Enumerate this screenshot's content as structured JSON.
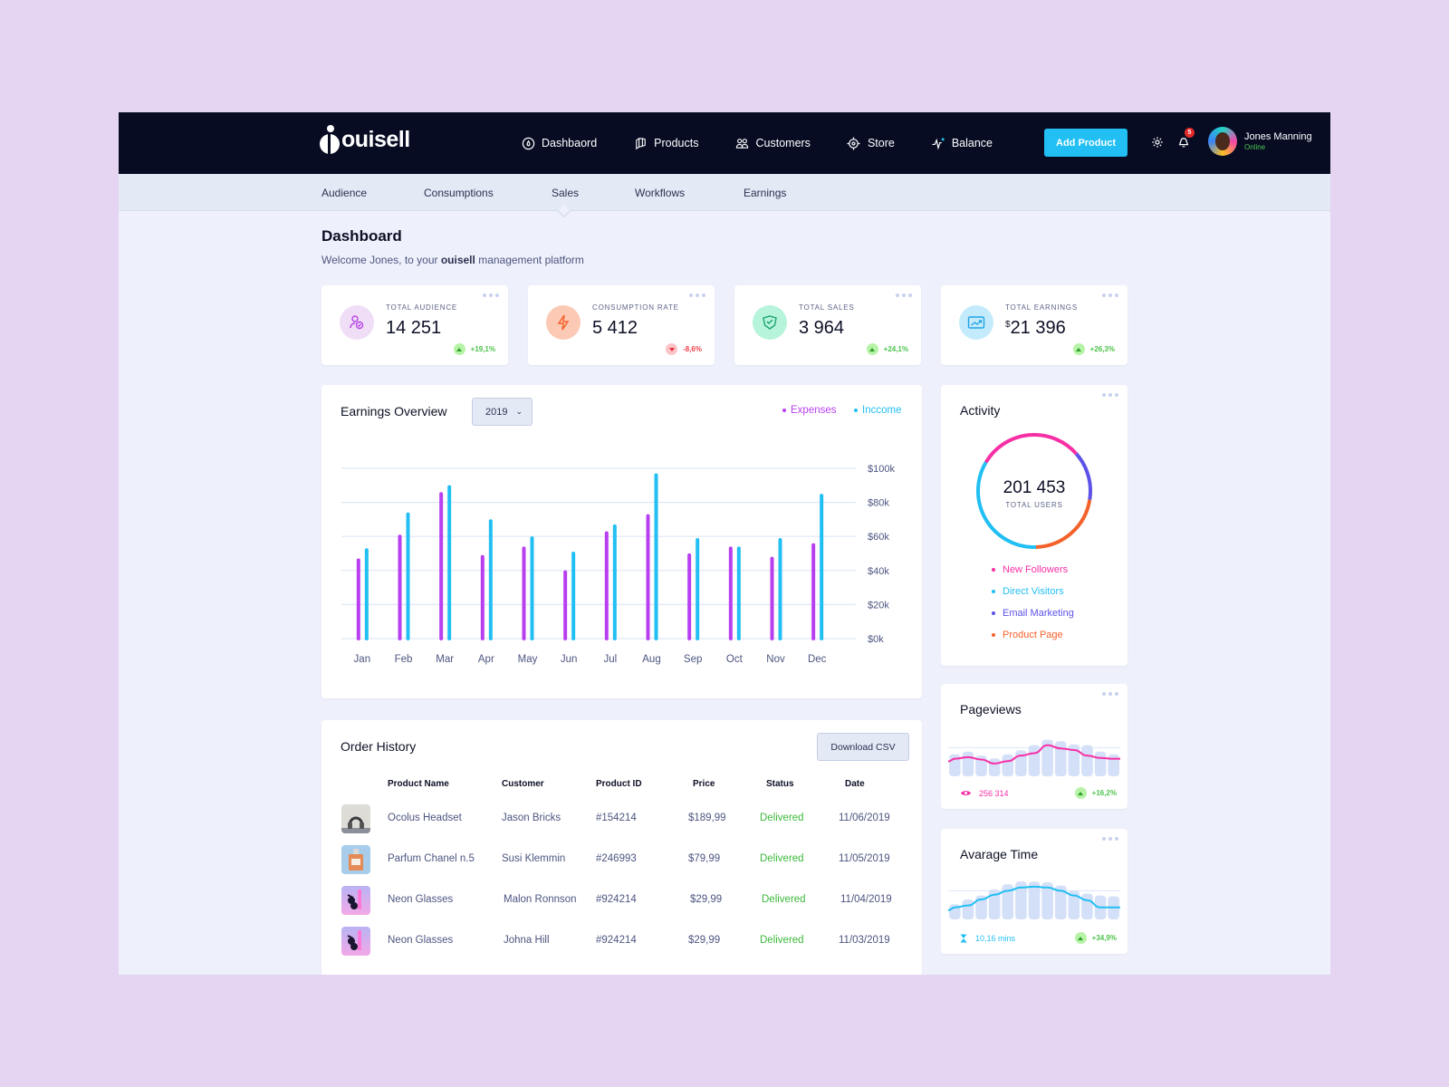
{
  "app": {
    "brand": "ouisell",
    "nav": [
      {
        "label": "Dashbaord",
        "icon": "gauge-icon"
      },
      {
        "label": "Products",
        "icon": "box-icon"
      },
      {
        "label": "Customers",
        "icon": "users-icon"
      },
      {
        "label": "Store",
        "icon": "target-icon"
      },
      {
        "label": "Balance",
        "icon": "pulse-icon"
      }
    ],
    "add_product_label": "Add Product",
    "notification_count": "5",
    "user": {
      "name": "Jones Manning",
      "status": "Online"
    }
  },
  "subnav": {
    "items": [
      "Audience",
      "Consumptions",
      "Sales",
      "Workflows",
      "Earnings"
    ],
    "active": "Sales"
  },
  "header": {
    "title": "Dashboard",
    "welcome_prefix": "Welcome Jones, to your ",
    "welcome_brand": "ouisell",
    "welcome_suffix": " management platform"
  },
  "stats": [
    {
      "label": "TOTAL AUDIENCE",
      "value": "14 251",
      "currency": "",
      "delta": "+19,1%",
      "trend": "up",
      "icon": "audience-icon",
      "color": "#b845e6",
      "bg": "#f0def7"
    },
    {
      "label": "CONSUMPTION RATE",
      "value": "5 412",
      "currency": "",
      "delta": "-8,6%",
      "trend": "down",
      "icon": "lightning-icon",
      "color": "#f4622c",
      "bg": "#fcc9b5"
    },
    {
      "label": "TOTAL SALES",
      "value": "3 964",
      "currency": "",
      "delta": "+24,1%",
      "trend": "up",
      "icon": "sales-tag-icon",
      "color": "#1aa36f",
      "bg": "#b7f4dc"
    },
    {
      "label": "TOTAL EARNINGS",
      "value": "21 396",
      "currency": "$",
      "delta": "+26,3%",
      "trend": "up",
      "icon": "earnings-chart-icon",
      "color": "#1fa4e6",
      "bg": "#c4ebfb"
    }
  ],
  "earnings": {
    "title": "Earnings Overview",
    "year": "2019",
    "legend": [
      {
        "label": "Expenses",
        "color": "#b83ff0"
      },
      {
        "label": "Inccome",
        "color": "#21bff3"
      }
    ]
  },
  "chart_data": [
    {
      "type": "bar",
      "title": "Earnings Overview",
      "categories": [
        "Jan",
        "Feb",
        "Mar",
        "Apr",
        "May",
        "Jun",
        "Jul",
        "Aug",
        "Sep",
        "Oct",
        "Nov",
        "Dec"
      ],
      "series": [
        {
          "name": "Expenses",
          "color": "#b83ff0",
          "values": [
            46,
            60,
            85,
            48,
            53,
            39,
            62,
            72,
            49,
            53,
            47,
            55
          ]
        },
        {
          "name": "Inccome",
          "color": "#21bff3",
          "values": [
            52,
            73,
            89,
            69,
            59,
            50,
            66,
            96,
            58,
            53,
            58,
            84
          ]
        }
      ],
      "y_ticks": [
        "$0k",
        "$20k",
        "$40k",
        "$60k",
        "$80k",
        "$100k"
      ],
      "ylim": [
        0,
        100
      ],
      "yunit": "k$",
      "grid": true,
      "legend_position": "top-right"
    },
    {
      "type": "pie",
      "title": "Activity",
      "center_value": "201 453",
      "center_label": "TOTAL USERS",
      "slices": [
        {
          "label": "New Followers",
          "color": "#f72fa5",
          "share": 30
        },
        {
          "label": "Email Marketing",
          "color": "#5d52e8",
          "share": 14
        },
        {
          "label": "Product Page",
          "color": "#f4622c",
          "share": 22
        },
        {
          "label": "Direct Visitors",
          "color": "#21bff3",
          "share": 34
        }
      ]
    },
    {
      "type": "area",
      "title": "Pageviews",
      "bars": [
        55,
        62,
        52,
        45,
        55,
        65,
        78,
        92,
        88,
        80,
        78,
        62,
        55
      ],
      "line": [
        44,
        48,
        42,
        32,
        38,
        52,
        58,
        78,
        70,
        66,
        52,
        46,
        44
      ]
    },
    {
      "type": "area",
      "title": "Avarage Time",
      "bars": [
        38,
        50,
        60,
        75,
        88,
        95,
        95,
        93,
        85,
        72,
        65,
        60,
        58
      ],
      "line": [
        30,
        35,
        50,
        62,
        72,
        80,
        82,
        80,
        72,
        60,
        48,
        30,
        30
      ]
    }
  ],
  "activity": {
    "title": "Activity",
    "total": "201 453",
    "total_label": "TOTAL USERS",
    "legend": [
      {
        "label": "New Followers",
        "color": "#f72fa5"
      },
      {
        "label": "Direct Visitors",
        "color": "#21bff3"
      },
      {
        "label": "Email Marketing",
        "color": "#5d52e8"
      },
      {
        "label": "Product Page",
        "color": "#f4622c"
      }
    ]
  },
  "pageviews": {
    "title": "Pageviews",
    "value": "256 314",
    "delta": "+16,2%",
    "line_color": "#f72fa5"
  },
  "avg_time": {
    "title": "Avarage Time",
    "value": "10,16 mins",
    "delta": "+34,9%",
    "line_color": "#21bff3"
  },
  "orders": {
    "title": "Order History",
    "download_label": "Download CSV",
    "columns": [
      "Product Name",
      "Customer",
      "Product ID",
      "Price",
      "Status",
      "Date"
    ],
    "rows": [
      {
        "product": "Ocolus Headset",
        "customer": "Jason Bricks",
        "id": "#154214",
        "price": "$189,99",
        "status": "Delivered",
        "date": "11/06/2019",
        "thumb": "headset"
      },
      {
        "product": "Parfum Chanel n.5",
        "customer": "Susi Klemmin",
        "id": "#246993",
        "price": "$79,99",
        "status": "Delivered",
        "date": "11/05/2019",
        "thumb": "perfume"
      },
      {
        "product": "Neon Glasses",
        "customer": "Malon Ronnson",
        "id": "#924214",
        "price": "$29,99",
        "status": "Delivered",
        "date": "11/04/2019",
        "thumb": "glasses"
      },
      {
        "product": "Neon Glasses",
        "customer": "Johna Hill",
        "id": "#924214",
        "price": "$29,99",
        "status": "Delivered",
        "date": "11/03/2019",
        "thumb": "glasses"
      }
    ]
  }
}
